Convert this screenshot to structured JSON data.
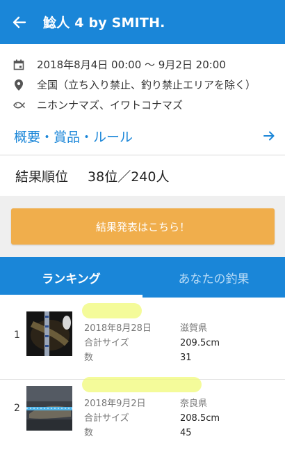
{
  "header": {
    "title": "鯰人 4 by SMITH."
  },
  "info": {
    "date": "2018年8月4日 00:00 〜 9月2日 20:00",
    "area": "全国（立ち入り禁止、釣り禁止エリアを除く）",
    "species": "ニホンナマズ、イワトコナマズ",
    "link_label": "概要・賞品・ルール"
  },
  "ranking": {
    "label": "結果順位",
    "value": "38位／240人"
  },
  "result_button": {
    "label": "結果発表はこちら！"
  },
  "tabs": [
    {
      "label": "ランキング",
      "active": true
    },
    {
      "label": "あなたの釣果",
      "active": false
    }
  ],
  "entries": [
    {
      "rank": "1",
      "date": "2018年8月28日",
      "size_label": "合計サイズ",
      "count_label": "数",
      "prefecture": "滋賀県",
      "size": "209.5cm",
      "count": "31"
    },
    {
      "rank": "2",
      "date": "2018年9月2日",
      "size_label": "合計サイズ",
      "count_label": "数",
      "prefecture": "奈良県",
      "size": "208.5cm",
      "count": "45"
    }
  ],
  "colors": {
    "primary": "#1a86d8",
    "button": "#f0ae4c",
    "highlight": "#f0fa78"
  }
}
